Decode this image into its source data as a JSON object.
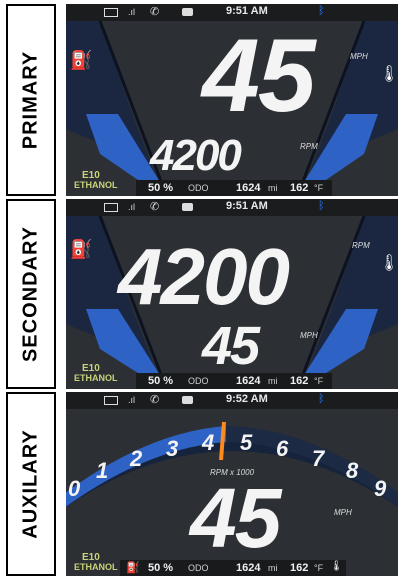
{
  "status_bar": [
    {
      "time": "9:51 AM"
    },
    {
      "time": "9:51 AM"
    },
    {
      "time": "9:52 AM"
    }
  ],
  "panels": [
    {
      "label": "PRIMARY",
      "speed": "45",
      "speed_unit": "MPH",
      "rpm": "4200",
      "rpm_unit": "RPM",
      "fuel_type": "E10",
      "fuel_name": "ETHANOL",
      "fuel_level": "50 %",
      "odo_label": "ODO",
      "odo_value": "1624",
      "odo_unit": "mi",
      "temp_value": "162",
      "temp_unit": "°F"
    },
    {
      "label": "SECONDARY",
      "speed": "45",
      "speed_unit": "MPH",
      "rpm": "4200",
      "rpm_unit": "RPM",
      "fuel_type": "E10",
      "fuel_name": "ETHANOL",
      "fuel_level": "50 %",
      "odo_label": "ODO",
      "odo_value": "1624",
      "odo_unit": "mi",
      "temp_value": "162",
      "temp_unit": "°F"
    },
    {
      "label": "AUXILARY",
      "speed": "45",
      "speed_unit": "MPH",
      "rpm_scale_label": "RPM x 1000",
      "rpm_ticks": [
        "0",
        "1",
        "2",
        "3",
        "4",
        "5",
        "6",
        "7",
        "8",
        "9"
      ],
      "fuel_type": "E10",
      "fuel_name": "ETHANOL",
      "fuel_level": "50 %",
      "odo_label": "ODO",
      "odo_value": "1624",
      "odo_unit": "mi",
      "temp_value": "162",
      "temp_unit": "°F"
    }
  ],
  "colors": {
    "gauge_blue": "#2e62c4",
    "screen_bg": "#2c2f33",
    "needle": "#ff8a1c",
    "ethanol": "#c9d37a"
  }
}
